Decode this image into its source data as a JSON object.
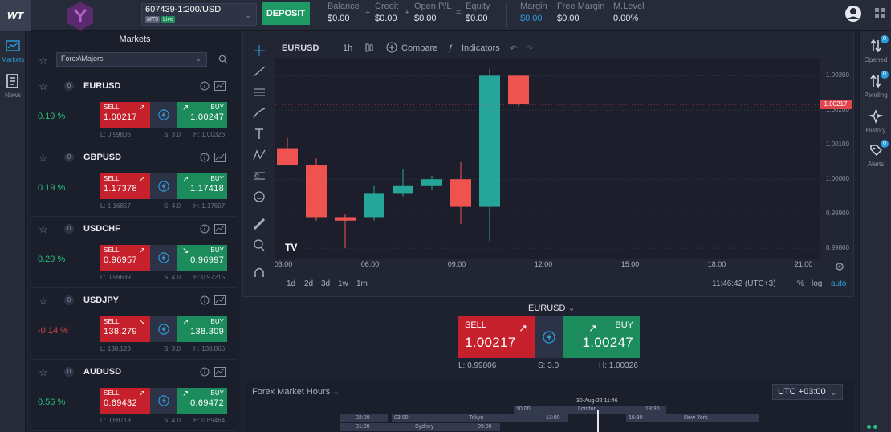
{
  "app": {
    "logo": "WT"
  },
  "account": {
    "id": "607439-1:200/USD",
    "platform": "MT5",
    "status": "Live",
    "deposit_label": "DEPOSIT"
  },
  "stats": {
    "balance": {
      "label": "Balance",
      "value": "$0.00"
    },
    "credit": {
      "label": "Credit",
      "value": "$0.00"
    },
    "openpl": {
      "label": "Open P/L",
      "value": "$0.00"
    },
    "equity": {
      "label": "Equity",
      "value": "$0.00"
    },
    "margin": {
      "label": "Margin",
      "value": "$0.00"
    },
    "free_margin": {
      "label": "Free Margin",
      "value": "$0.00"
    },
    "mlevel": {
      "label": "M.Level",
      "value": "0.00%"
    }
  },
  "left_rail": {
    "markets": "Markets",
    "news": "News"
  },
  "markets": {
    "title": "Markets",
    "category": "Forex\\Majors",
    "rows": [
      {
        "symbol": "EURUSD",
        "count": "0",
        "change": "0.19 %",
        "sell_label": "SELL",
        "sell_price": "1.00217",
        "buy_label": "BUY",
        "buy_price": "1.00247",
        "low": "L: 0.99806",
        "spread": "S: 3.0",
        "high": "H: 1.00326"
      },
      {
        "symbol": "GBPUSD",
        "count": "0",
        "change": "0.19 %",
        "sell_label": "SELL",
        "sell_price": "1.17378",
        "buy_label": "BUY",
        "buy_price": "1.17418",
        "low": "L: 1.16857",
        "spread": "S: 4.0",
        "high": "H: 1.17607"
      },
      {
        "symbol": "USDCHF",
        "count": "0",
        "change": "0.29 %",
        "sell_label": "SELL",
        "sell_price": "0.96957",
        "buy_label": "BUY",
        "buy_price": "0.96997",
        "low": "L: 0.96639",
        "spread": "S: 4.0",
        "high": "H: 0.97215"
      },
      {
        "symbol": "USDJPY",
        "count": "0",
        "change": "-0.14 %",
        "sell_label": "SELL",
        "sell_price": "138.279",
        "buy_label": "BUY",
        "buy_price": "138.309",
        "low": "L: 138.123",
        "spread": "S: 3.0",
        "high": "H: 138.865"
      },
      {
        "symbol": "AUDUSD",
        "count": "0",
        "change": "0.56 %",
        "sell_label": "SELL",
        "sell_price": "0.69432",
        "buy_label": "BUY",
        "buy_price": "0.69472",
        "low": "L: 0.68713",
        "spread": "S: 4.0",
        "high": "H: 0.69464"
      }
    ]
  },
  "chart": {
    "symbol": "EURUSD",
    "interval": "1h",
    "compare": "Compare",
    "indicators": "Indicators",
    "price_labels": [
      "1.00300",
      "1.00200",
      "1.00100",
      "1.00000",
      "0.99900",
      "0.99800"
    ],
    "last_price": "1.00217",
    "time_labels": [
      "03:00",
      "06:00",
      "09:00",
      "12:00",
      "15:00",
      "18:00",
      "21:00"
    ],
    "periods": [
      "1d",
      "2d",
      "3d",
      "1w",
      "1m"
    ],
    "clock": "11:46:42 (UTC+3)",
    "scale_opts": [
      "%",
      "log",
      "auto"
    ],
    "candles": [
      {
        "o": 1.0009,
        "h": 1.0012,
        "l": 1.0004,
        "c": 1.0004
      },
      {
        "o": 1.0004,
        "h": 1.0006,
        "l": 0.9988,
        "c": 0.9989
      },
      {
        "o": 0.9989,
        "h": 0.999,
        "l": 0.998,
        "c": 0.9988
      },
      {
        "o": 0.9989,
        "h": 0.9998,
        "l": 0.9988,
        "c": 0.9996
      },
      {
        "o": 0.9996,
        "h": 1.0003,
        "l": 0.9995,
        "c": 0.9998
      },
      {
        "o": 0.9998,
        "h": 1.0001,
        "l": 0.9997,
        "c": 1.0
      },
      {
        "o": 1.0,
        "h": 1.0005,
        "l": 0.9987,
        "c": 0.9992
      },
      {
        "o": 0.9992,
        "h": 1.0032,
        "l": 0.9982,
        "c": 1.003
      },
      {
        "o": 1.003,
        "h": 1.003,
        "l": 1.0021,
        "c": 1.00217
      }
    ]
  },
  "trade": {
    "symbol": "EURUSD",
    "sell_label": "SELL",
    "sell_price": "1.00217",
    "buy_label": "BUY",
    "buy_price": "1.00247",
    "low": "L: 0.99806",
    "spread": "S: 3.0",
    "high": "H: 1.00326"
  },
  "hours": {
    "title": "Forex Market Hours",
    "utc": "UTC +03:00",
    "now_label": "30-Aug-22 11:46",
    "sessions": [
      {
        "name": "Sydney",
        "start": "01:00",
        "end": "09:00"
      },
      {
        "name": "Tokyo",
        "start": "03:00",
        "end": "13:00"
      },
      {
        "name": "London",
        "start": "10:00",
        "end": "18:30"
      },
      {
        "name": "New York",
        "start": "16:30",
        "end": ""
      }
    ],
    "extra_time": "02:00"
  },
  "right_rail": {
    "opened": "Opened",
    "pending": "Pending",
    "history": "History",
    "alerts": "Alerts",
    "opened_count": "0",
    "pending_count": "0",
    "alerts_count": "0"
  },
  "colors": {
    "sell": "#c5202b",
    "buy": "#1c8c5c",
    "bull": "#26a69a",
    "bear": "#ef5350",
    "accent": "#2d9cdb"
  }
}
